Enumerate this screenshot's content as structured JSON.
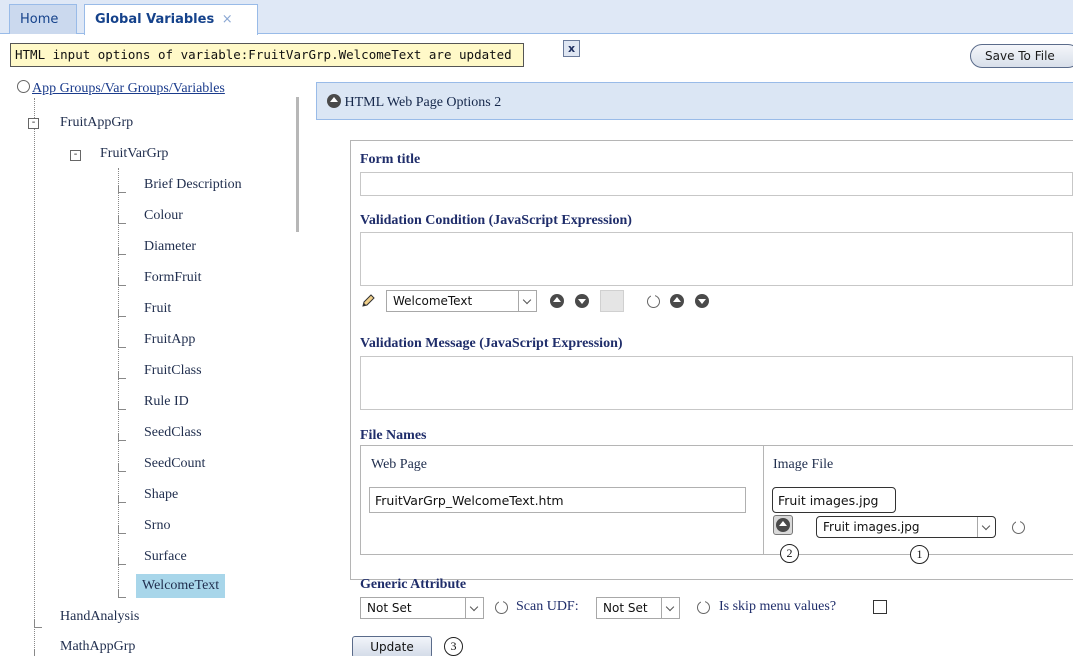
{
  "tabs": [
    {
      "label": "Home"
    },
    {
      "label": "Global Variables",
      "close": "×"
    }
  ],
  "notice": {
    "text": "HTML input options of variable:FruitVarGrp.WelcomeText are updated",
    "close_label": "x"
  },
  "toolbar": {
    "save_label": "Save To File"
  },
  "tree": {
    "root_label": "App Groups/Var Groups/Variables",
    "app_group": "FruitAppGrp",
    "var_group": "FruitVarGrp",
    "variables": [
      "Brief Description",
      "Colour",
      "Diameter",
      "FormFruit",
      "Fruit",
      "FruitApp",
      "FruitClass",
      "Rule ID",
      "SeedClass",
      "SeedCount",
      "Shape",
      "Srno",
      "Surface",
      "WelcomeText"
    ],
    "selected": "WelcomeText",
    "other_groups": [
      "HandAnalysis",
      "MathAppGrp"
    ]
  },
  "panel": {
    "title": "HTML Web Page Options 2",
    "form_title_label": "Form title",
    "form_title_value": "",
    "validation_condition_label": "Validation Condition (JavaScript Expression)",
    "variable_dropdown": "WelcomeText",
    "validation_message_label": "Validation Message (JavaScript Expression)",
    "file_names_label": "File Names",
    "web_page_label": "Web Page",
    "web_page_value": "FruitVarGrp_WelcomeText.htm",
    "image_file_label": "Image File",
    "image_file_value": "Fruit images.jpg",
    "image_dropdown": "Fruit images.jpg",
    "generic_attribute_label": "Generic Attribute",
    "generic_attribute_value": "Not Set",
    "scan_udf_label": "Scan UDF:",
    "scan_udf_value": "Not Set",
    "skip_menu_label": "Is skip menu values?",
    "update_label": "Update"
  },
  "callouts": [
    "1",
    "2",
    "3"
  ]
}
